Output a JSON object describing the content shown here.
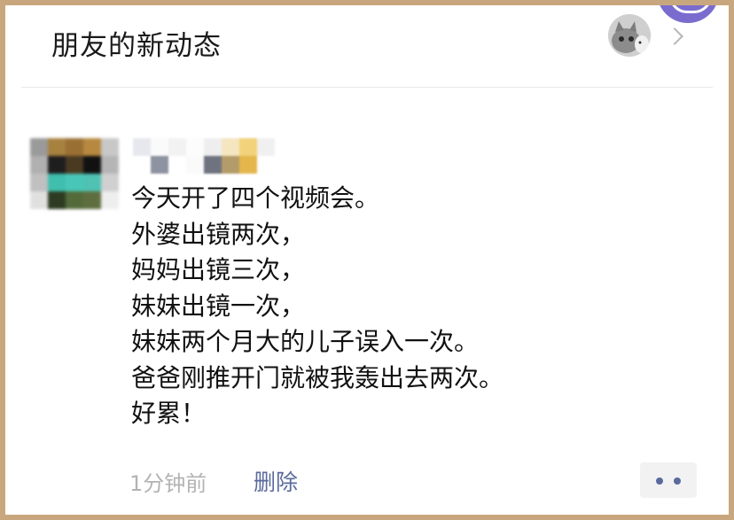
{
  "header": {
    "title": "朋友的新动态"
  },
  "post": {
    "lines": [
      "今天开了四个视频会。",
      "外婆出镜两次，",
      "妈妈出镜三次，",
      "妹妹出镜一次，",
      "妹妹两个月大的儿子误入一次。",
      "爸爸刚推开门就被我轰出去两次。",
      "好累！"
    ],
    "time": "1分钟前",
    "delete_label": "删除"
  },
  "colors": {
    "link": "#5a6a9c",
    "frame": "#c9a77e",
    "muted": "#b3b3b3"
  },
  "icons": {
    "more": "more-dots-icon",
    "chevron": "chevron-right-icon"
  }
}
